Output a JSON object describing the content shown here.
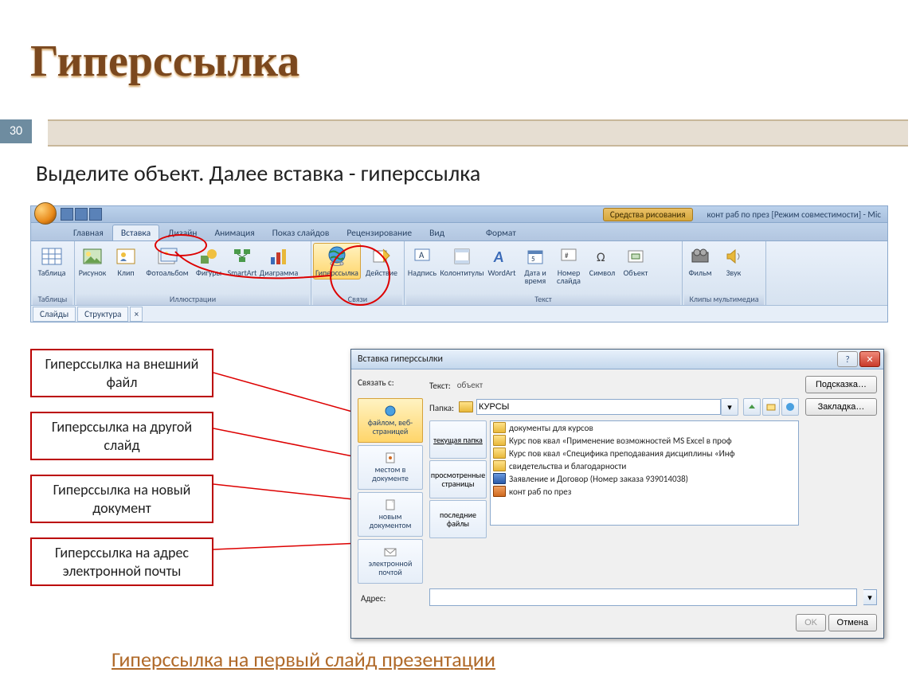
{
  "page_number": "30",
  "title": "Гиперссылка",
  "instruction": "Выделите объект. Далее вставка - гиперссылка",
  "bottom_link": "Гиперссылка на первый слайд презентации",
  "window_context_tab": "Средства рисования",
  "window_title_text": "конт раб по през [Режим совместимости] - Mic",
  "tabs": {
    "home": "Главная",
    "insert": "Вставка",
    "design": "Дизайн",
    "anim": "Анимация",
    "slideshow": "Показ слайдов",
    "review": "Рецензирование",
    "view": "Вид",
    "format": "Формат"
  },
  "groups": {
    "tables": "Таблицы",
    "illustrations": "Иллюстрации",
    "links": "Связи",
    "text": "Текст",
    "media": "Клипы мультимедиа"
  },
  "buttons": {
    "table": "Таблица",
    "picture": "Рисунок",
    "clip": "Клип",
    "album": "Фотоальбом",
    "shapes": "Фигуры",
    "smartart": "SmartArt",
    "chart": "Диаграмма",
    "hyperlink": "Гиперссылка",
    "action": "Действие",
    "textbox": "Надпись",
    "header": "Колонтитулы",
    "wordart": "WordArt",
    "datetime": "Дата и время",
    "slidenum": "Номер слайда",
    "symbol": "Символ",
    "object": "Объект",
    "movie": "Фильм",
    "sound": "Звук"
  },
  "mini_tabs": {
    "slides": "Слайды",
    "structure": "Структура"
  },
  "labels": [
    "Гиперссылка на внешний файл",
    "Гиперссылка на другой слайд",
    "Гиперссылка на новый документ",
    "Гиперссылка на адрес электронной почты"
  ],
  "dialog": {
    "title": "Вставка гиперссылки",
    "link_with": "Связать с:",
    "text_label": "Текст:",
    "text_value": "объект",
    "tooltip_btn": "Подсказка…",
    "folder_label": "Папка:",
    "folder_value": "КУРСЫ",
    "bookmark_btn": "Закладка…",
    "address_label": "Адрес:",
    "ok": "OK",
    "cancel": "Отмена",
    "link_types": {
      "file_web": "файлом, веб-страницей",
      "place": "местом в документе",
      "new_doc": "новым документом",
      "email": "электронной почтой"
    },
    "browse_tabs": {
      "current": "текущая папка",
      "viewed": "просмотренные страницы",
      "recent": "последние файлы"
    },
    "files": [
      {
        "icon": "folder",
        "name": "документы для курсов"
      },
      {
        "icon": "folder",
        "name": "Курс пов квал «Применение возможностей MS Excel в проф"
      },
      {
        "icon": "folder",
        "name": "Курс пов квал «Специфика преподавания дисциплины «Инф"
      },
      {
        "icon": "folder",
        "name": "свидетельства и благодарности"
      },
      {
        "icon": "word",
        "name": "Заявление и Договор (Номер заказа 939014038)"
      },
      {
        "icon": "ppt",
        "name": "конт раб по през"
      }
    ]
  }
}
